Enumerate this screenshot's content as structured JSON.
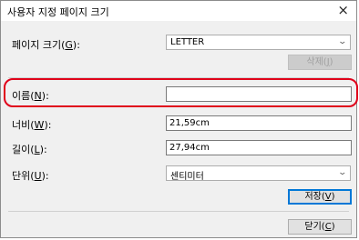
{
  "window": {
    "title": "사용자 지정 페이지 크기",
    "close": "×"
  },
  "page_size": {
    "label_pre": "페이지 크기(",
    "label_key": "G",
    "label_post": "):",
    "value": "LETTER",
    "delete_pre": "삭제(",
    "delete_key": "J",
    "delete_post": ")"
  },
  "name": {
    "label_pre": "이름(",
    "label_key": "N",
    "label_post": "):",
    "value": ""
  },
  "width": {
    "label_pre": "너비(",
    "label_key": "W",
    "label_post": "):",
    "value": "21,59cm"
  },
  "length": {
    "label_pre": "길이(",
    "label_key": "L",
    "label_post": "):",
    "value": "27,94cm"
  },
  "unit": {
    "label_pre": "단위(",
    "label_key": "U",
    "label_post": "):",
    "value": "센티미터"
  },
  "save": {
    "pre": "저장(",
    "key": "V",
    "post": ")"
  },
  "close_btn": {
    "pre": "닫기(",
    "key": "C",
    "post": ")"
  },
  "colors": {
    "highlight": "#e0001a",
    "focus": "#0078d7",
    "dialog_bg": "#f0f0f0"
  }
}
